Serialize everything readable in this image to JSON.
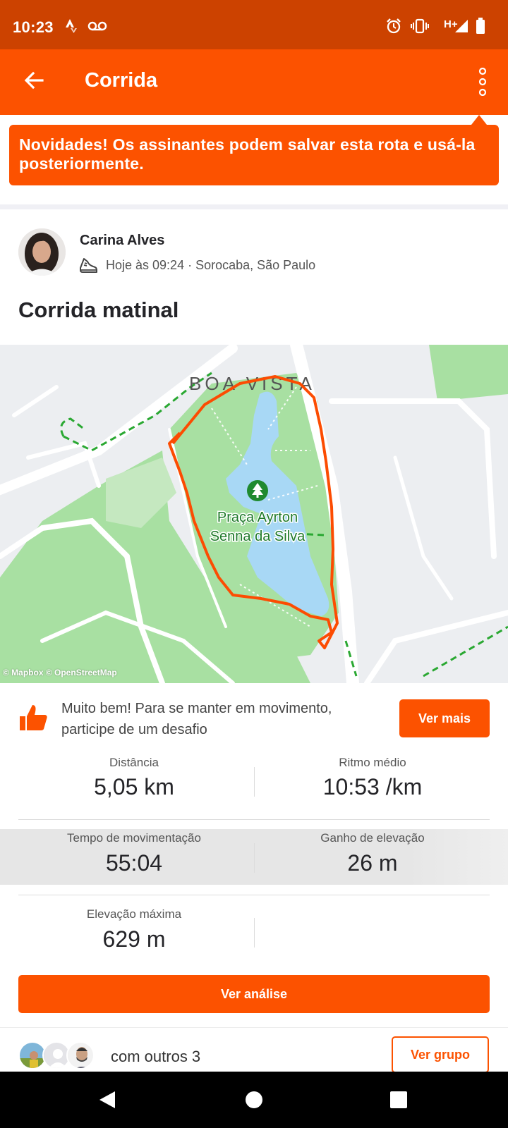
{
  "status_bar": {
    "time": "10:23",
    "network": "H+",
    "icons": [
      "strava-notification-icon",
      "voicemail-icon",
      "alarm-icon",
      "vibrate-icon",
      "signal-icon",
      "battery-icon"
    ]
  },
  "app_bar": {
    "title": "Corrida",
    "back_icon": "arrow-left-icon",
    "menu_icon": "more-vertical-icon"
  },
  "tooltip": {
    "text": "Novidades! Os assinantes podem salvar esta rota e usá-la posteriormente."
  },
  "activity": {
    "athlete_name": "Carina Alves",
    "meta": "Hoje às 09:24 · Sorocaba, São Paulo",
    "title": "Corrida matinal"
  },
  "map": {
    "neighborhood_label": "BOA VISTA",
    "park_name_line1": "Praça Ayrton",
    "park_name_line2": "Senna da Silva",
    "credit": "© Mapbox © OpenStreetMap",
    "route_color": "#fc4c02"
  },
  "kudos_prompt": {
    "text": "Muito bem! Para se manter em movimento, participe de um desafio",
    "button_label": "Ver mais"
  },
  "stats": [
    {
      "label": "Distância",
      "value": "5,05 km"
    },
    {
      "label": "Ritmo médio",
      "value": "10:53 /km"
    },
    {
      "label": "Tempo de movimentação",
      "value": "55:04"
    },
    {
      "label": "Ganho de elevação",
      "value": "26 m"
    },
    {
      "label": "Elevação máxima",
      "value": "629 m"
    }
  ],
  "analysis_button": "Ver análise",
  "group": {
    "text": "com outros 3",
    "button_label": "Ver grupo"
  },
  "colors": {
    "brand": "#fc5200",
    "status_bar": "#cc4200"
  }
}
